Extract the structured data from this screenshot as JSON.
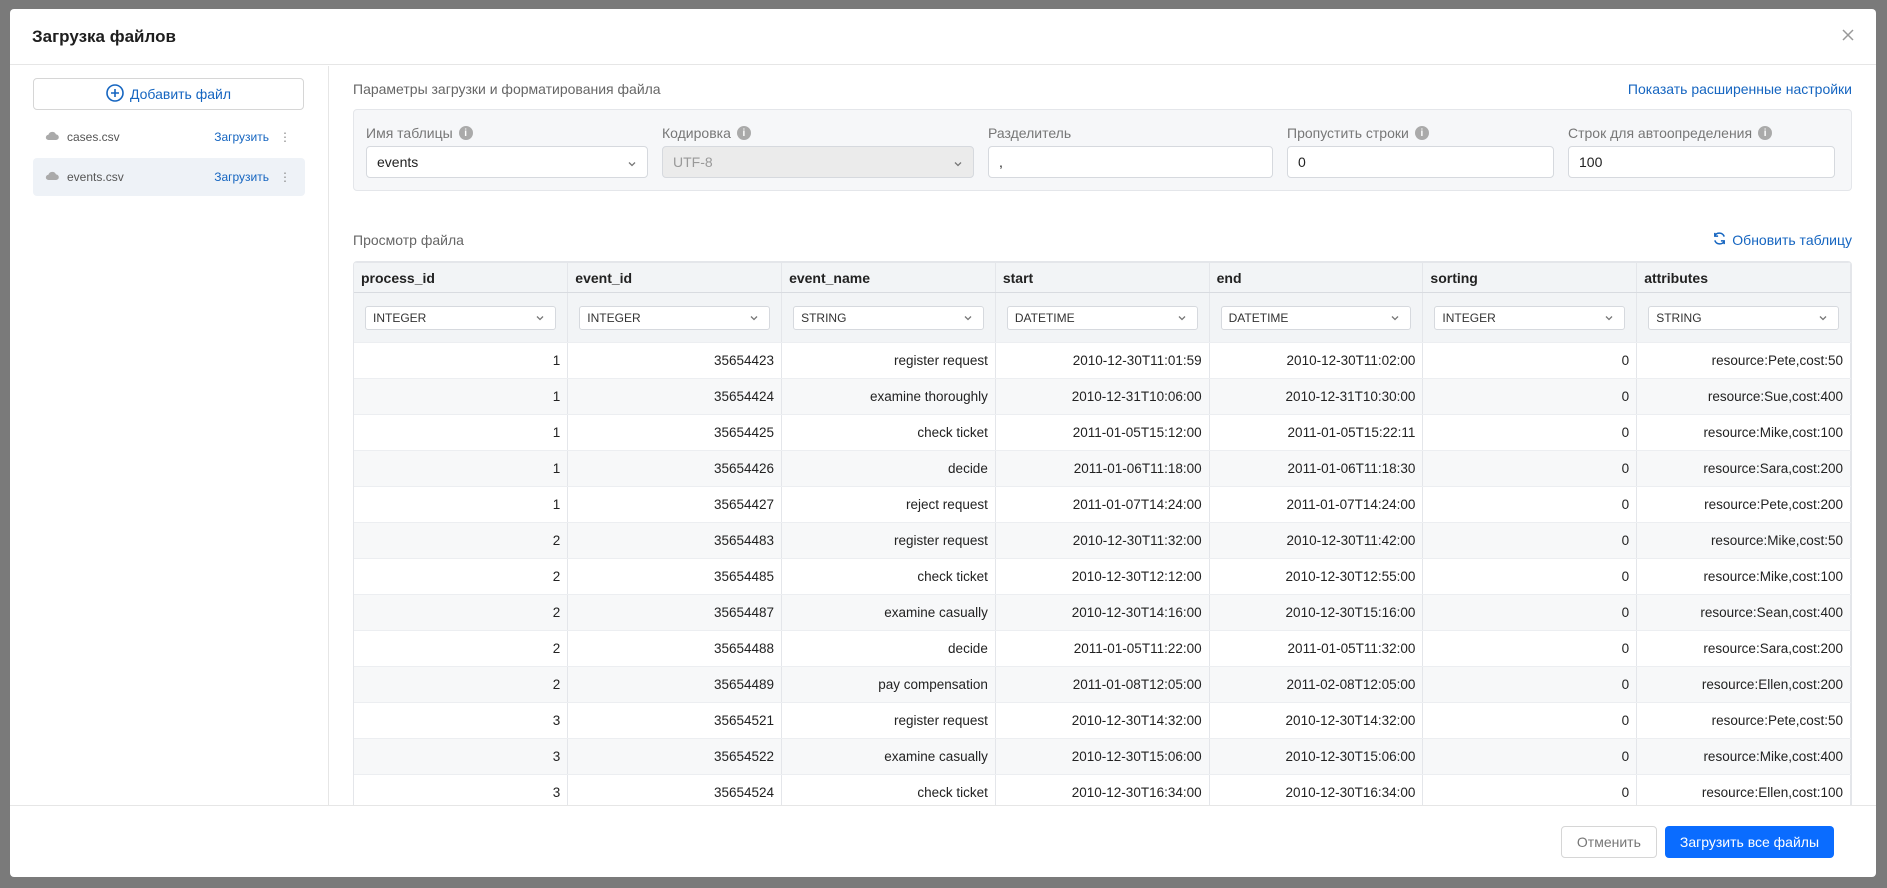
{
  "modal": {
    "title": "Загрузка файлов"
  },
  "sidebar": {
    "add_file_label": "Добавить файл",
    "files": [
      {
        "name": "cases.csv",
        "action": "Загрузить"
      },
      {
        "name": "events.csv",
        "action": "Загрузить"
      }
    ]
  },
  "params": {
    "section_title": "Параметры загрузки и форматирования файла",
    "advanced_link": "Показать расширенные настройки",
    "table_name": {
      "label": "Имя таблицы",
      "value": "events"
    },
    "encoding": {
      "label": "Кодировка",
      "value": "UTF-8"
    },
    "delimiter": {
      "label": "Разделитель",
      "value": ","
    },
    "skip_rows": {
      "label": "Пропустить строки",
      "value": "0"
    },
    "autodetect_rows": {
      "label": "Строк для автоопределения",
      "value": "100"
    }
  },
  "preview": {
    "section_title": "Просмотр файла",
    "refresh_label": "Обновить таблицу",
    "types": [
      "INTEGER",
      "INTEGER",
      "STRING",
      "DATETIME",
      "DATETIME",
      "INTEGER",
      "STRING"
    ],
    "columns": [
      "process_id",
      "event_id",
      "event_name",
      "start",
      "end",
      "sorting",
      "attributes"
    ],
    "rows": [
      [
        "1",
        "35654423",
        "register request",
        "2010-12-30T11:01:59",
        "2010-12-30T11:02:00",
        "0",
        "resource:Pete,cost:50"
      ],
      [
        "1",
        "35654424",
        "examine thoroughly",
        "2010-12-31T10:06:00",
        "2010-12-31T10:30:00",
        "0",
        "resource:Sue,cost:400"
      ],
      [
        "1",
        "35654425",
        "check ticket",
        "2011-01-05T15:12:00",
        "2011-01-05T15:22:11",
        "0",
        "resource:Mike,cost:100"
      ],
      [
        "1",
        "35654426",
        "decide",
        "2011-01-06T11:18:00",
        "2011-01-06T11:18:30",
        "0",
        "resource:Sara,cost:200"
      ],
      [
        "1",
        "35654427",
        "reject request",
        "2011-01-07T14:24:00",
        "2011-01-07T14:24:00",
        "0",
        "resource:Pete,cost:200"
      ],
      [
        "2",
        "35654483",
        "register request",
        "2010-12-30T11:32:00",
        "2010-12-30T11:42:00",
        "0",
        "resource:Mike,cost:50"
      ],
      [
        "2",
        "35654485",
        "check ticket",
        "2010-12-30T12:12:00",
        "2010-12-30T12:55:00",
        "0",
        "resource:Mike,cost:100"
      ],
      [
        "2",
        "35654487",
        "examine casually",
        "2010-12-30T14:16:00",
        "2010-12-30T15:16:00",
        "0",
        "resource:Sean,cost:400"
      ],
      [
        "2",
        "35654488",
        "decide",
        "2011-01-05T11:22:00",
        "2011-01-05T11:32:00",
        "0",
        "resource:Sara,cost:200"
      ],
      [
        "2",
        "35654489",
        "pay compensation",
        "2011-01-08T12:05:00",
        "2011-02-08T12:05:00",
        "0",
        "resource:Ellen,cost:200"
      ],
      [
        "3",
        "35654521",
        "register request",
        "2010-12-30T14:32:00",
        "2010-12-30T14:32:00",
        "0",
        "resource:Pete,cost:50"
      ],
      [
        "3",
        "35654522",
        "examine casually",
        "2010-12-30T15:06:00",
        "2010-12-30T15:06:00",
        "0",
        "resource:Mike,cost:400"
      ],
      [
        "3",
        "35654524",
        "check ticket",
        "2010-12-30T16:34:00",
        "2010-12-30T16:34:00",
        "0",
        "resource:Ellen,cost:100"
      ]
    ]
  },
  "footer": {
    "cancel_label": "Отменить",
    "submit_label": "Загрузить все файлы"
  }
}
